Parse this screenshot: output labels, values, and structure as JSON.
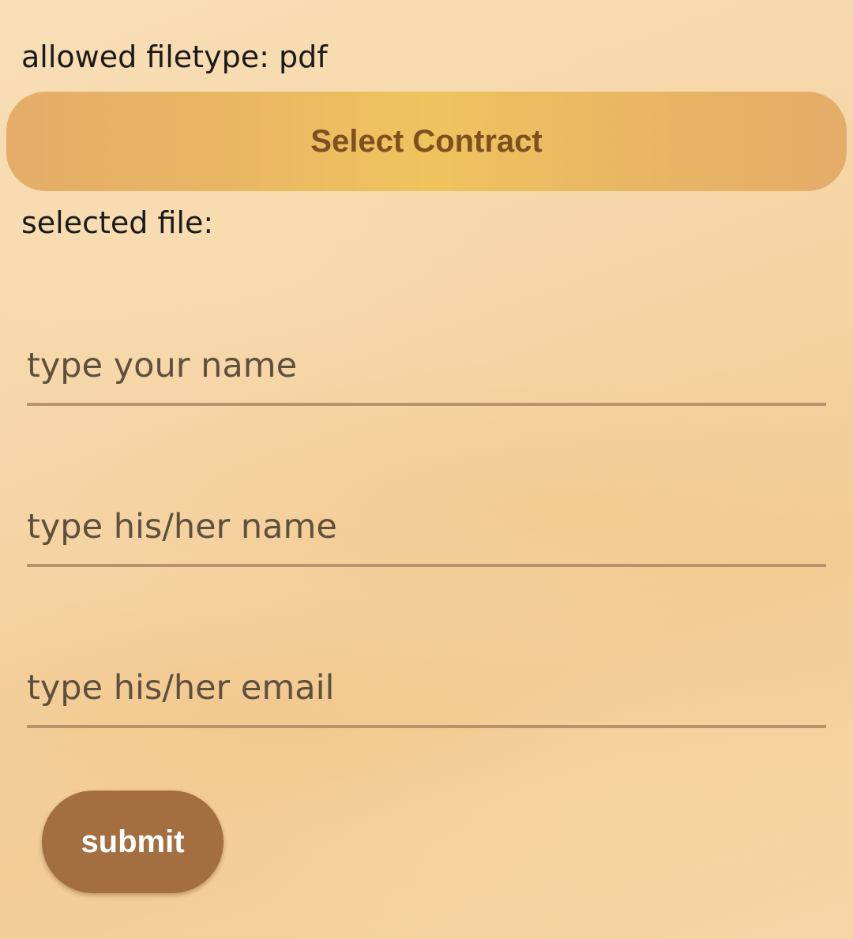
{
  "upload": {
    "allowed_filetype_label": "allowed filetype: pdf",
    "select_button_label": "Select Contract",
    "selected_file_label": "selected file:"
  },
  "form": {
    "your_name": {
      "value": "",
      "placeholder": "type your name"
    },
    "his_her_name": {
      "value": "",
      "placeholder": "type his/her name"
    },
    "his_her_email": {
      "value": "",
      "placeholder": "type his/her email"
    },
    "submit_label": "submit"
  },
  "colors": {
    "select_button_text": "#7f4f1f",
    "submit_button_bg": "#a46f40",
    "input_underline": "#ba936d"
  }
}
